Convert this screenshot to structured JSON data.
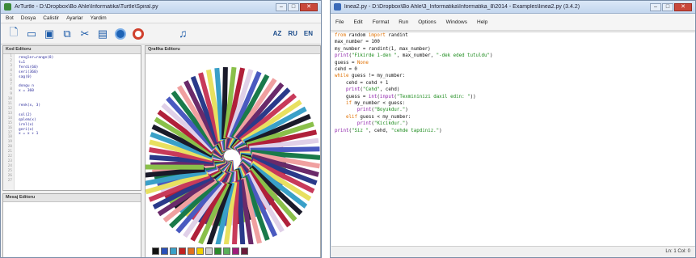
{
  "left_window": {
    "title": "ArTurtle - D:\\Dropbox\\Bo Ahle\\Informatika\\Turtle\\Spiral.py",
    "menu": [
      "Bot",
      "Dosya",
      "Calistir",
      "Ayarlar",
      "Yardim"
    ],
    "lang_labels": [
      "AZ",
      "RU",
      "EN"
    ],
    "code_pane_title": "Kod Editoru",
    "message_pane_title": "Mesaj Editoru",
    "drawing_pane_title": "Qrafika Editoru",
    "code_lines": [
      "rengler=range(8)",
      "t=1",
      "ferdi(60)",
      "seri(360)",
      "sag(0)",
      "",
      "dongu n",
      "x = 360",
      "",
      "",
      "renk(x, 3)",
      "",
      "sol(2)",
      "qalem(x)",
      "irel(x)",
      "geri(x)",
      "x = x + 1"
    ],
    "palette": [
      "#111111",
      "#2a4fb8",
      "#3aa0c8",
      "#c02020",
      "#e07020",
      "#f0d000",
      "#d0d0d0",
      "#2a8a2a",
      "#5ab05a",
      "#a01a7a",
      "#6a1a3a"
    ],
    "spiral_colors": [
      "#2a3a8a",
      "#c83a5a",
      "#e8e060",
      "#3aa0c8",
      "#1a1a2a",
      "#8ac04a",
      "#b0203a",
      "#e0d0e8",
      "#4a5ac0",
      "#1a7a4a",
      "#f0a0a0",
      "#6a2a6a"
    ]
  },
  "right_window": {
    "title": "linea2.py - D:\\Dropbox\\Bo Ahle\\3_Informatika\\Informatika_8\\2014 - Examples\\linea2.py (3.4.2)",
    "menu": [
      "File",
      "Edit",
      "Format",
      "Run",
      "Options",
      "Windows",
      "Help"
    ],
    "code_lines": [
      {
        "parts": [
          {
            "t": "from",
            "c": "kw"
          },
          {
            "t": " random ",
            "c": ""
          },
          {
            "t": "import",
            "c": "kw"
          },
          {
            "t": " randint",
            "c": ""
          }
        ]
      },
      {
        "parts": [
          {
            "t": "max_number = 100",
            "c": ""
          }
        ]
      },
      {
        "parts": [
          {
            "t": "my_number = randint(1, max_number)",
            "c": ""
          }
        ]
      },
      {
        "parts": [
          {
            "t": "print",
            "c": "bi"
          },
          {
            "t": "(",
            "c": ""
          },
          {
            "t": "\"Fikirde 1-den \"",
            "c": "str"
          },
          {
            "t": ", max_number, ",
            "c": ""
          },
          {
            "t": "\"-dek eded tutuldu\"",
            "c": "str"
          },
          {
            "t": ")",
            "c": ""
          }
        ]
      },
      {
        "parts": [
          {
            "t": "guess = ",
            "c": ""
          },
          {
            "t": "None",
            "c": "kw"
          }
        ]
      },
      {
        "parts": [
          {
            "t": "cehd = 0",
            "c": ""
          }
        ]
      },
      {
        "parts": [
          {
            "t": "while",
            "c": "kw"
          },
          {
            "t": " guess != my_number:",
            "c": ""
          }
        ]
      },
      {
        "parts": [
          {
            "t": "    cehd = cehd + 1",
            "c": ""
          }
        ]
      },
      {
        "parts": [
          {
            "t": "    ",
            "c": ""
          },
          {
            "t": "print",
            "c": "bi"
          },
          {
            "t": "(",
            "c": ""
          },
          {
            "t": "\"Cehd\"",
            "c": "str"
          },
          {
            "t": ", cehd)",
            "c": ""
          }
        ]
      },
      {
        "parts": [
          {
            "t": "    guess = ",
            "c": ""
          },
          {
            "t": "int",
            "c": "bi"
          },
          {
            "t": "(",
            "c": ""
          },
          {
            "t": "input",
            "c": "bi"
          },
          {
            "t": "(",
            "c": ""
          },
          {
            "t": "\"Texmininizi daxil edin: \"",
            "c": "str"
          },
          {
            "t": "))",
            "c": ""
          }
        ]
      },
      {
        "parts": [
          {
            "t": "    ",
            "c": ""
          },
          {
            "t": "if",
            "c": "kw"
          },
          {
            "t": " my_number < guess:",
            "c": ""
          }
        ]
      },
      {
        "parts": [
          {
            "t": "        ",
            "c": ""
          },
          {
            "t": "print",
            "c": "bi"
          },
          {
            "t": "(",
            "c": ""
          },
          {
            "t": "\"Boyukdur.\"",
            "c": "str"
          },
          {
            "t": ")",
            "c": ""
          }
        ]
      },
      {
        "parts": [
          {
            "t": "    ",
            "c": ""
          },
          {
            "t": "elif",
            "c": "kw"
          },
          {
            "t": " guess < my_number:",
            "c": ""
          }
        ]
      },
      {
        "parts": [
          {
            "t": "        ",
            "c": ""
          },
          {
            "t": "print",
            "c": "bi"
          },
          {
            "t": "(",
            "c": ""
          },
          {
            "t": "\"Kicikdur.\"",
            "c": "str"
          },
          {
            "t": ")",
            "c": ""
          }
        ]
      },
      {
        "parts": [
          {
            "t": "print",
            "c": "bi"
          },
          {
            "t": "(",
            "c": ""
          },
          {
            "t": "\"Siz \"",
            "c": "str"
          },
          {
            "t": ", cehd, ",
            "c": ""
          },
          {
            "t": "\"cehde tapdiniz.\"",
            "c": "str"
          },
          {
            "t": ")",
            "c": ""
          }
        ]
      }
    ],
    "status": "Ln: 1  Col: 0"
  }
}
